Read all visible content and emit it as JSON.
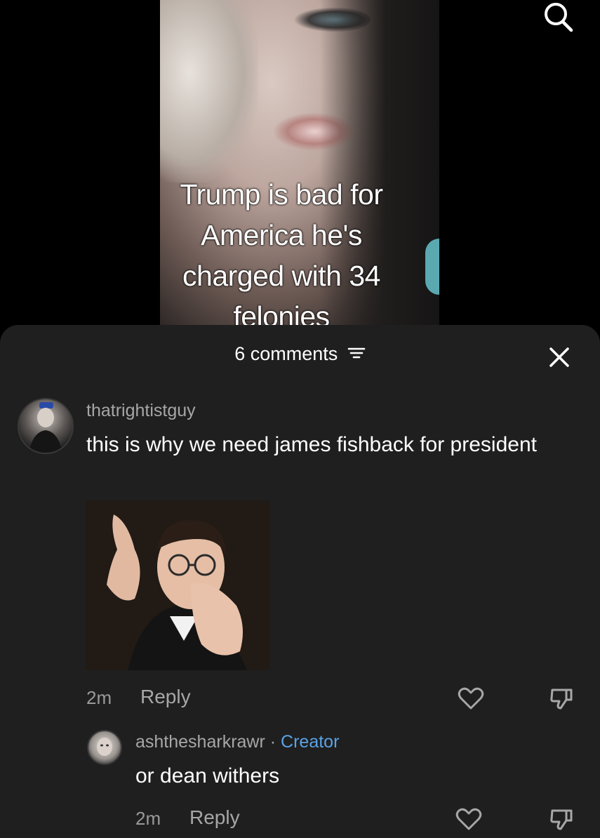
{
  "video": {
    "caption": "Trump is bad for America he's charged with 34 felonies",
    "search_icon": "search-icon"
  },
  "comments_sheet": {
    "count_label": "6 comments",
    "sort_icon": "filter-lines-icon",
    "close_icon": "close-icon",
    "comments": [
      {
        "username": "thatrightistguy",
        "text": "this is why we need james fishback for president",
        "image_alt": "man with glasses in suit laughing and pointing",
        "time": "2m",
        "reply_label": "Reply",
        "like_icon": "heart-outline-icon",
        "dislike_icon": "thumbs-down-icon"
      },
      {
        "username": "ashthesharkrawr",
        "separator": "·",
        "badge": "Creator",
        "text": "or dean withers",
        "time": "2m",
        "reply_label": "Reply",
        "like_icon": "heart-outline-icon",
        "dislike_icon": "thumbs-down-icon"
      }
    ]
  },
  "colors": {
    "sheet_bg": "#1f1f1f",
    "creator_badge": "#59a3e6",
    "muted_text": "#a7a7a7"
  }
}
